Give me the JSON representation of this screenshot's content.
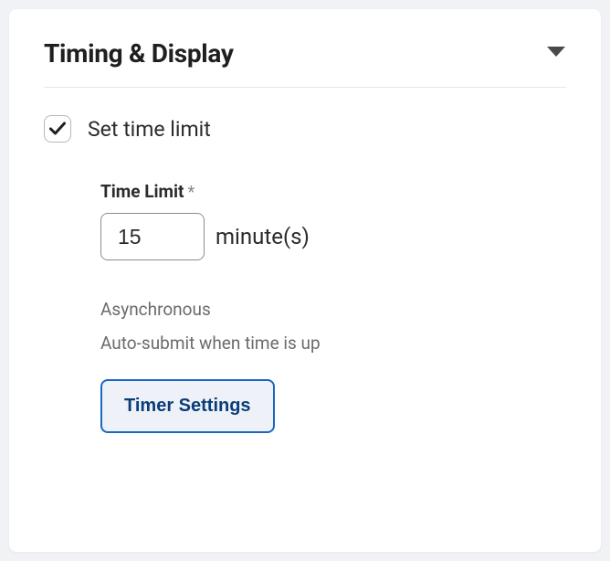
{
  "section": {
    "title": "Timing & Display"
  },
  "timeLimit": {
    "checkboxLabel": "Set time limit",
    "checked": true,
    "fieldLabel": "Time Limit",
    "requiredMark": "*",
    "value": "15",
    "unit": "minute(s)",
    "modeText": "Asynchronous",
    "autoSubmitText": "Auto-submit when time is up",
    "settingsButton": "Timer Settings"
  }
}
